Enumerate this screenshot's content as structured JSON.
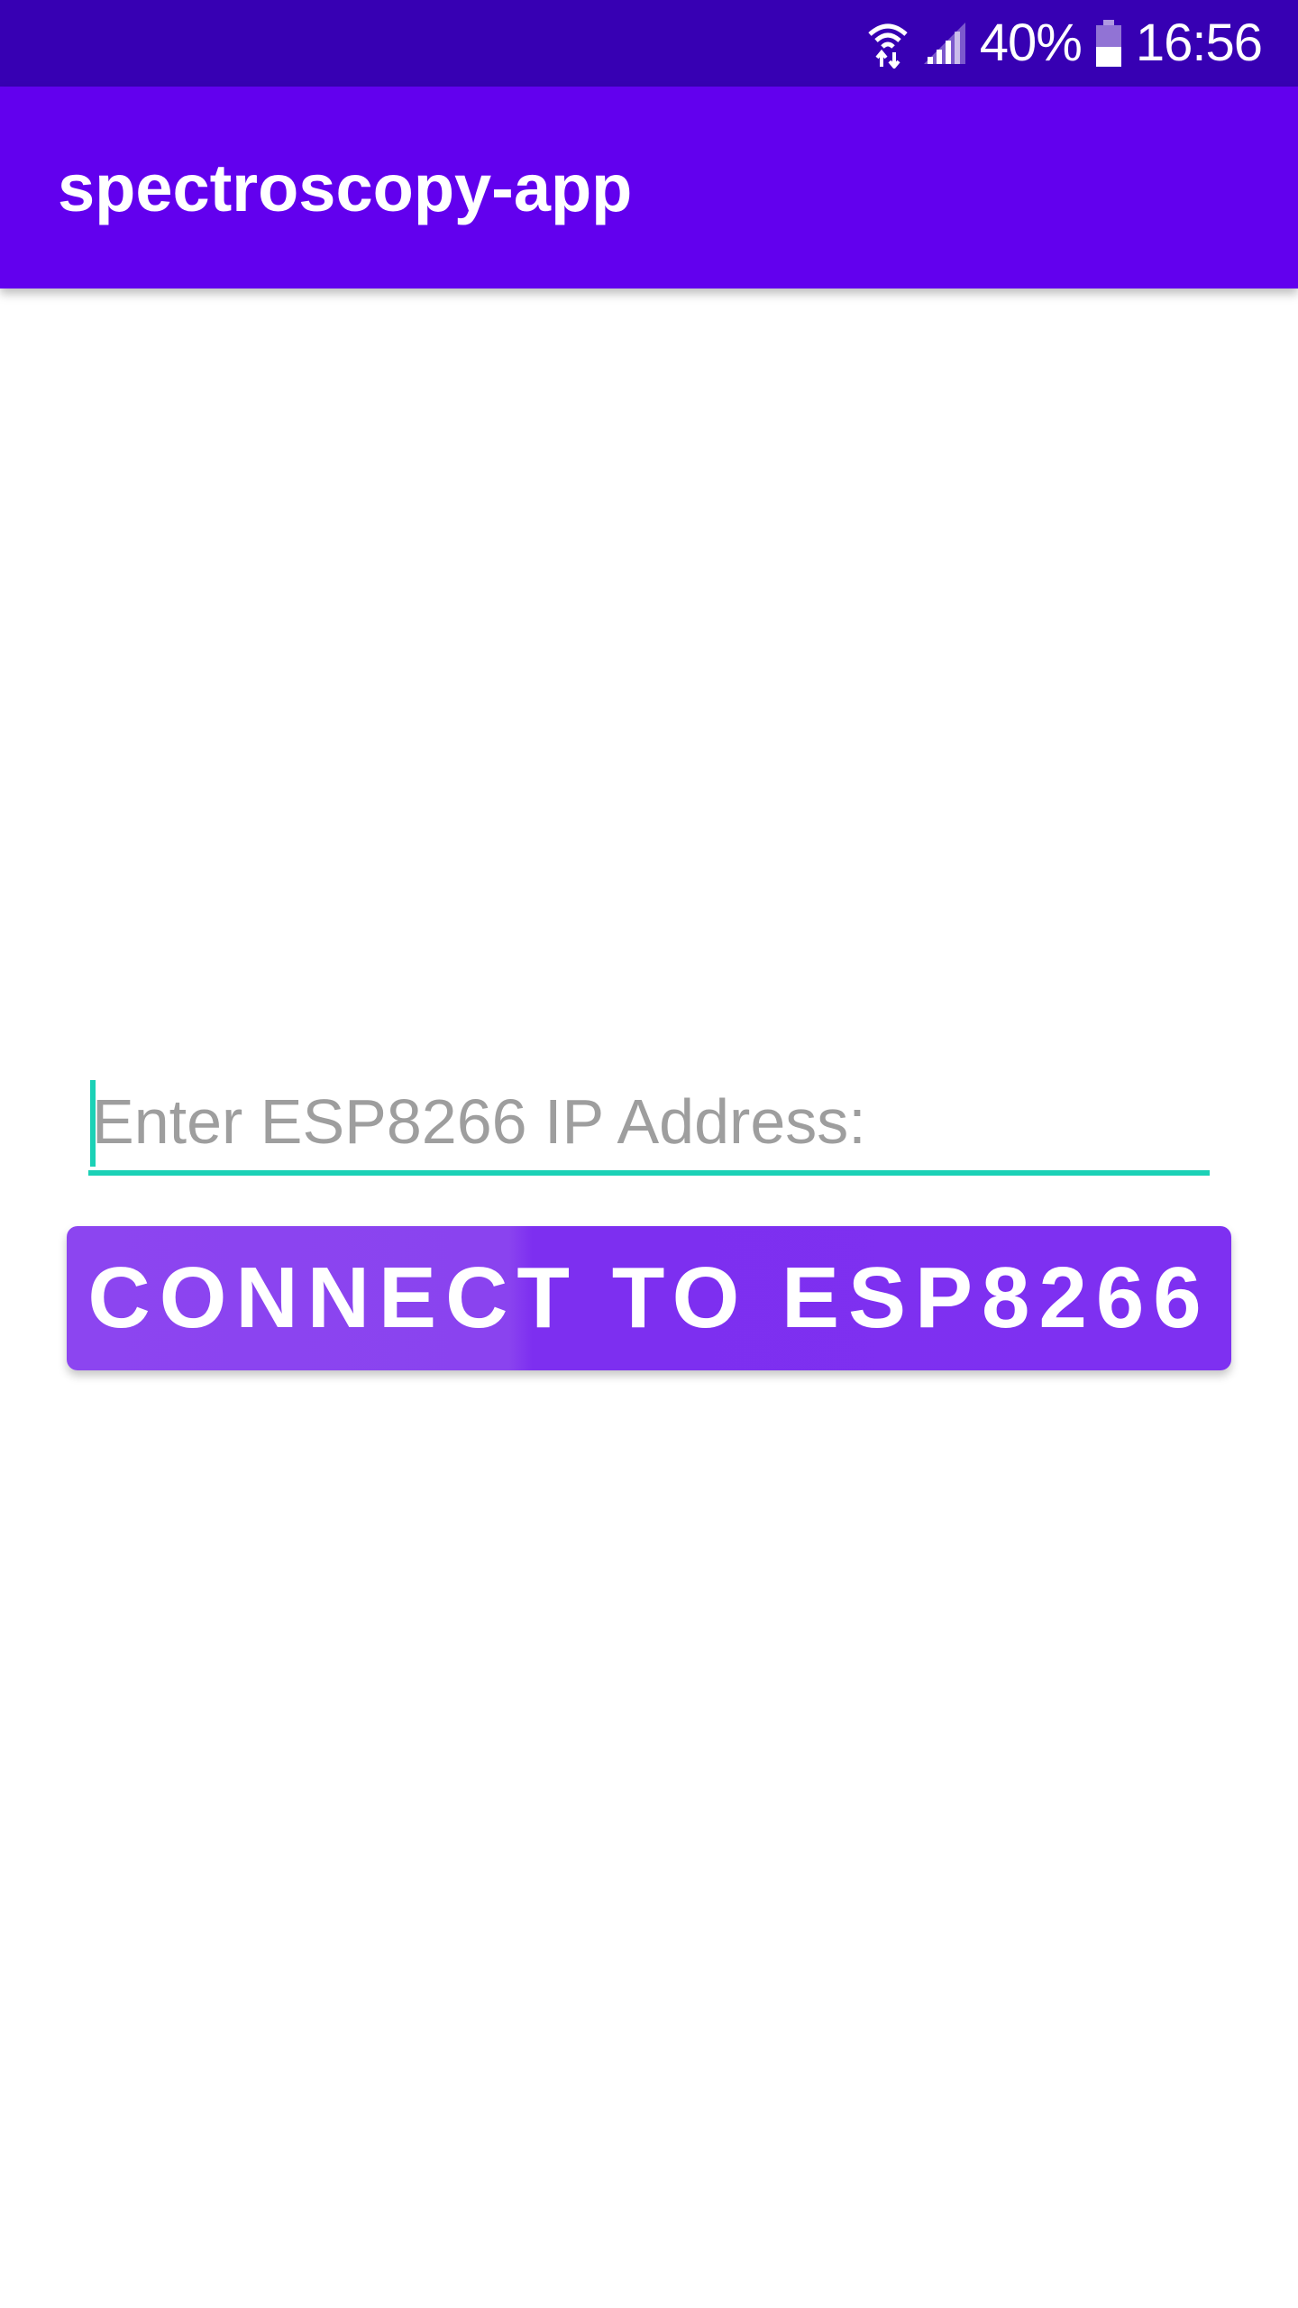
{
  "status_bar": {
    "icons": [
      "wifi-icon",
      "signal-icon",
      "battery-icon"
    ],
    "battery_percent": "40%",
    "time": "16:56"
  },
  "app_bar": {
    "title": "spectroscopy-app"
  },
  "form": {
    "ip_input": {
      "value": "",
      "placeholder": "Enter ESP8266 IP Address:"
    },
    "connect_button_label": "CONNECT TO ESP8266"
  },
  "colors": {
    "status_bar": "#3700b3",
    "app_bar": "#6200ee",
    "accent": "#1bd1b6",
    "button": "#7e30f1"
  }
}
